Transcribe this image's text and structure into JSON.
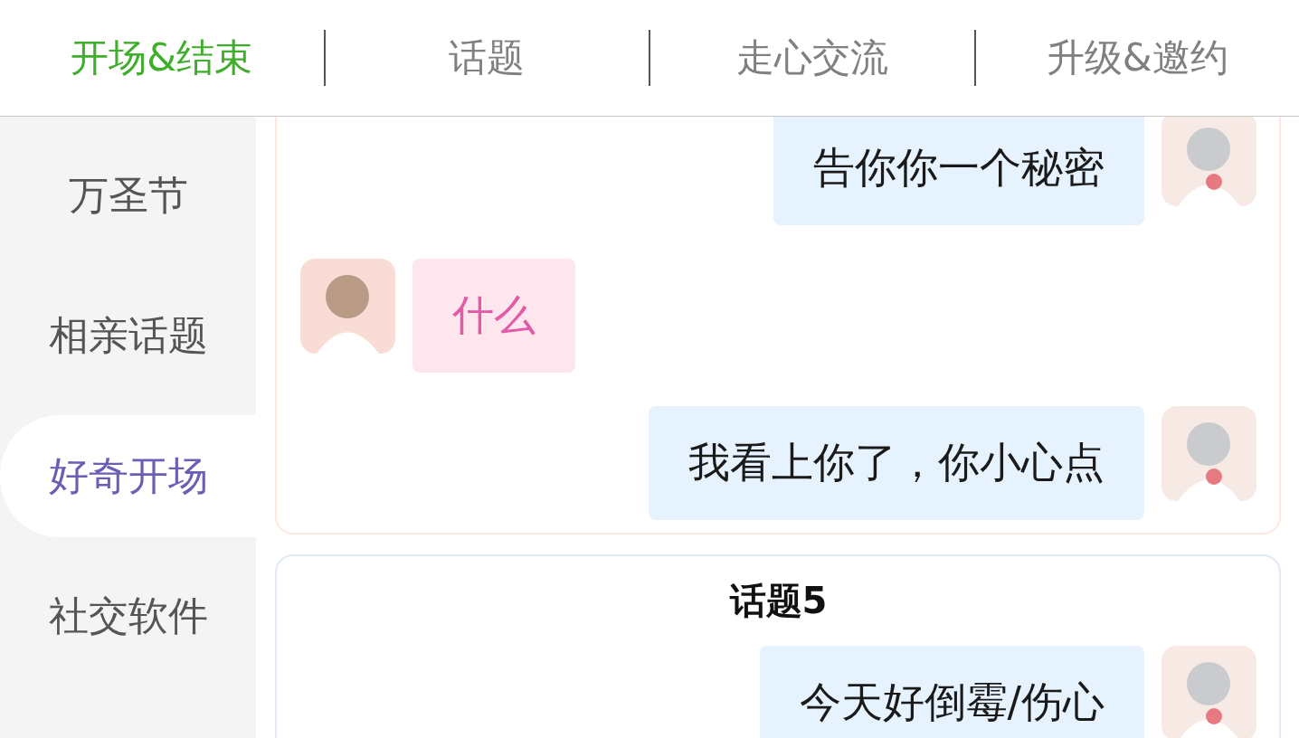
{
  "tabs": [
    {
      "label": "开场&结束",
      "selected": true
    },
    {
      "label": "话题",
      "selected": false
    },
    {
      "label": "走心交流",
      "selected": false
    },
    {
      "label": "升级&邀约",
      "selected": false
    }
  ],
  "sidebar": {
    "items": [
      {
        "label": "万圣节",
        "selected": false
      },
      {
        "label": "相亲话题",
        "selected": false
      },
      {
        "label": "好奇开场",
        "selected": true
      },
      {
        "label": "社交软件",
        "selected": false
      }
    ]
  },
  "cards": [
    {
      "messages": [
        {
          "kind": "right",
          "text": "告你你一个秘密"
        },
        {
          "kind": "left",
          "text": "什么"
        },
        {
          "kind": "right",
          "text": "我看上你了，你小心点"
        }
      ]
    },
    {
      "title": "话题5",
      "messages": [
        {
          "kind": "right",
          "text": "今天好倒霉/伤心"
        }
      ]
    }
  ]
}
